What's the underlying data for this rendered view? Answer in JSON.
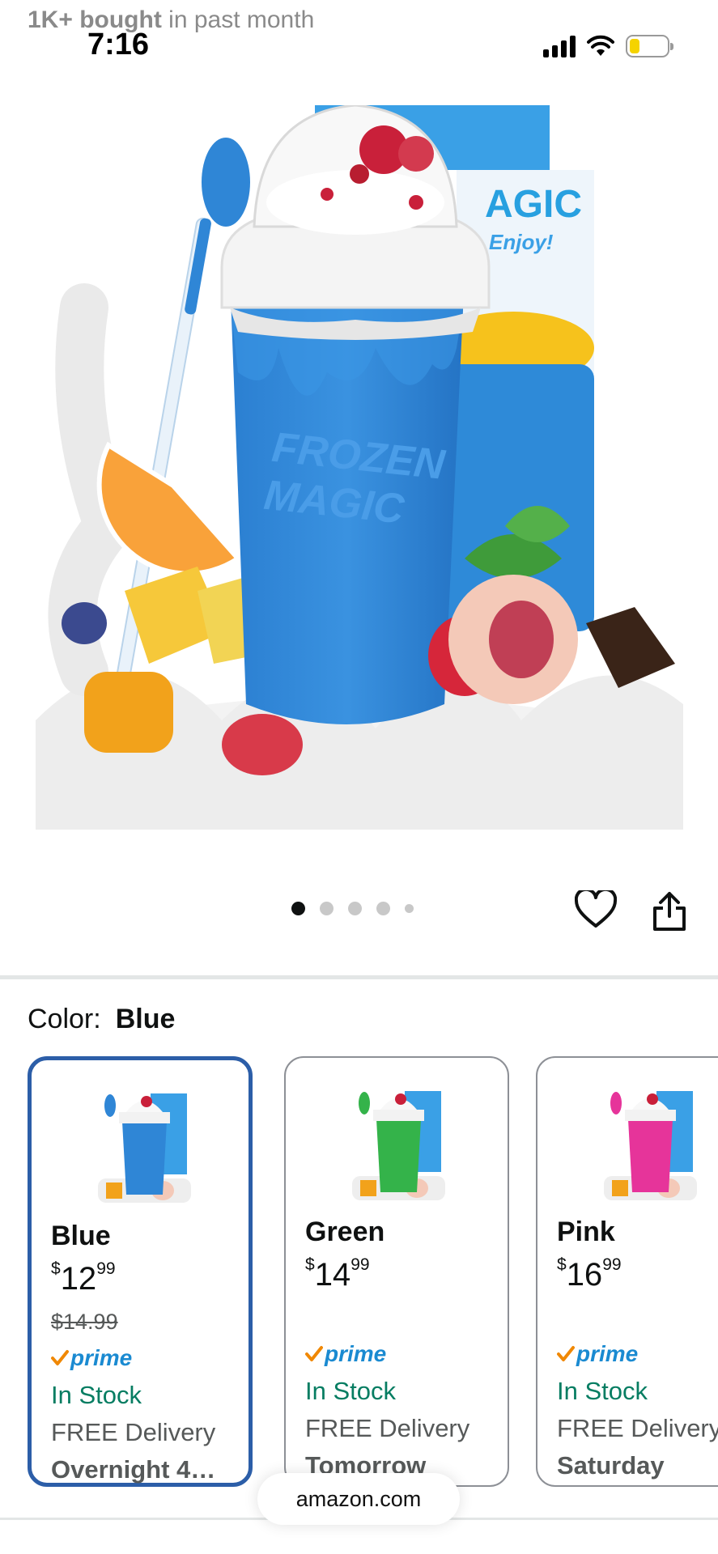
{
  "banner": {
    "bold": "1K+ bought",
    "rest": " in past month"
  },
  "status_bar": {
    "time": "7:16"
  },
  "product_image": {
    "cup_brand_line1": "FROZEN",
    "cup_brand_line2": "MAGIC",
    "box_text": "AGIC",
    "box_subtext": "Enjoy!",
    "colors": {
      "cup": "#2f86d6",
      "lid": "#f2f2f2",
      "box": "#2f9ce0"
    }
  },
  "carousel": {
    "total": 5,
    "active_index": 0
  },
  "color_selector": {
    "label": "Color:",
    "selected": "Blue"
  },
  "swatches": [
    {
      "name": "Blue",
      "price_dollar": "$",
      "price_whole": "12",
      "price_cents": "99",
      "old_price": "$14.99",
      "prime": "prime",
      "stock": "In Stock",
      "delivery": "FREE Delivery",
      "when": "Overnight 4…",
      "color": "#2f86d6"
    },
    {
      "name": "Green",
      "price_dollar": "$",
      "price_whole": "14",
      "price_cents": "99",
      "prime": "prime",
      "stock": "In Stock",
      "delivery": "FREE Delivery",
      "when": "Tomorrow",
      "color": "#34b34a"
    },
    {
      "name": "Pink",
      "price_dollar": "$",
      "price_whole": "16",
      "price_cents": "99",
      "prime": "prime",
      "stock": "In Stock",
      "delivery": "FREE Delivery",
      "when": "Saturday",
      "color": "#e6349a"
    }
  ],
  "browser": {
    "url": "amazon.com"
  },
  "theme": {
    "selected_border": "#2c5ea8",
    "prime_blue": "#1a8ad1",
    "prime_check": "#f08804",
    "stock_green": "#067d62"
  }
}
